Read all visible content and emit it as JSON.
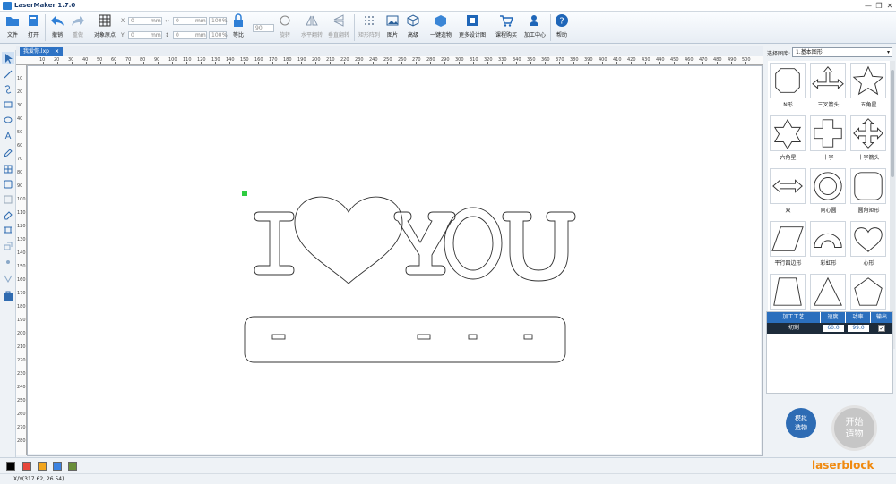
{
  "app": {
    "title": "LaserMaker 1.7.0"
  },
  "toolbar": {
    "file": "文件",
    "open": "打开",
    "undo": "撤销",
    "redo": "重做",
    "origin": "对象原点",
    "x_label": "X",
    "y_label": "Y",
    "x_value": "0",
    "y_value": "0",
    "w_value": "0",
    "h_value": "0",
    "w_pct": "100",
    "h_pct": "100",
    "unit_mm": "mm",
    "unit_pct": "%",
    "lock_ratio": "等比",
    "rotate_value": "90",
    "rotate": "旋转",
    "flip_h": "水平翻转",
    "flip_v": "垂直翻转",
    "array": "矩形阵列",
    "image": "图片",
    "advanced": "高级",
    "one_click": "一键造物",
    "more_designs": "更多设计图",
    "shop": "课程购买",
    "center": "加工中心",
    "help": "帮助"
  },
  "tab": {
    "label": "我爱你.lxp",
    "close": "×"
  },
  "ruler": {
    "h_ticks": [
      "10",
      "20",
      "30",
      "40",
      "50",
      "60",
      "70",
      "80",
      "90",
      "100",
      "110",
      "120",
      "130",
      "140",
      "150",
      "160",
      "170",
      "180",
      "190",
      "200",
      "210",
      "220",
      "230",
      "240",
      "250",
      "260",
      "270",
      "280",
      "290",
      "300",
      "310",
      "320",
      "330",
      "340",
      "350",
      "360",
      "370",
      "380",
      "390",
      "400",
      "410",
      "420",
      "430",
      "440",
      "450",
      "460",
      "470",
      "480",
      "490",
      "500"
    ],
    "v_ticks": [
      "10",
      "20",
      "30",
      "40",
      "50",
      "60",
      "70",
      "80",
      "90",
      "100",
      "110",
      "120",
      "130",
      "140",
      "150",
      "160",
      "170",
      "180",
      "190",
      "200",
      "210",
      "220",
      "230",
      "240",
      "250",
      "260",
      "270",
      "280"
    ]
  },
  "right_panel": {
    "library_label": "选择图库:",
    "library_value": "1.基本图形",
    "shapes": [
      {
        "name": "N形"
      },
      {
        "name": "三叉箭头"
      },
      {
        "name": "五角星"
      },
      {
        "name": "六角星"
      },
      {
        "name": "十字"
      },
      {
        "name": "十字箭头"
      },
      {
        "name": "双"
      },
      {
        "name": "同心圆"
      },
      {
        "name": "圆角矩形"
      },
      {
        "name": "平行四边形"
      },
      {
        "name": "彩虹形"
      },
      {
        "name": "心形"
      },
      {
        "name": ""
      },
      {
        "name": ""
      },
      {
        "name": ""
      }
    ],
    "table": {
      "headers": [
        "加工工艺",
        "速度",
        "功率",
        "输出"
      ],
      "row": {
        "process": "切割",
        "speed": "60.0",
        "power": "99.0",
        "output_check": "✓"
      }
    },
    "simulate": {
      "line1": "模拟",
      "line2": "造物"
    },
    "start": {
      "line1": "开始",
      "line2": "造物"
    }
  },
  "palette": {
    "colors": [
      "#000000",
      "#e8473a",
      "#f2a51c",
      "#3c82e0",
      "#6a8f3a"
    ]
  },
  "status": {
    "coords": "X/Y(317.62, 26.54)"
  },
  "brand": "laserblock"
}
